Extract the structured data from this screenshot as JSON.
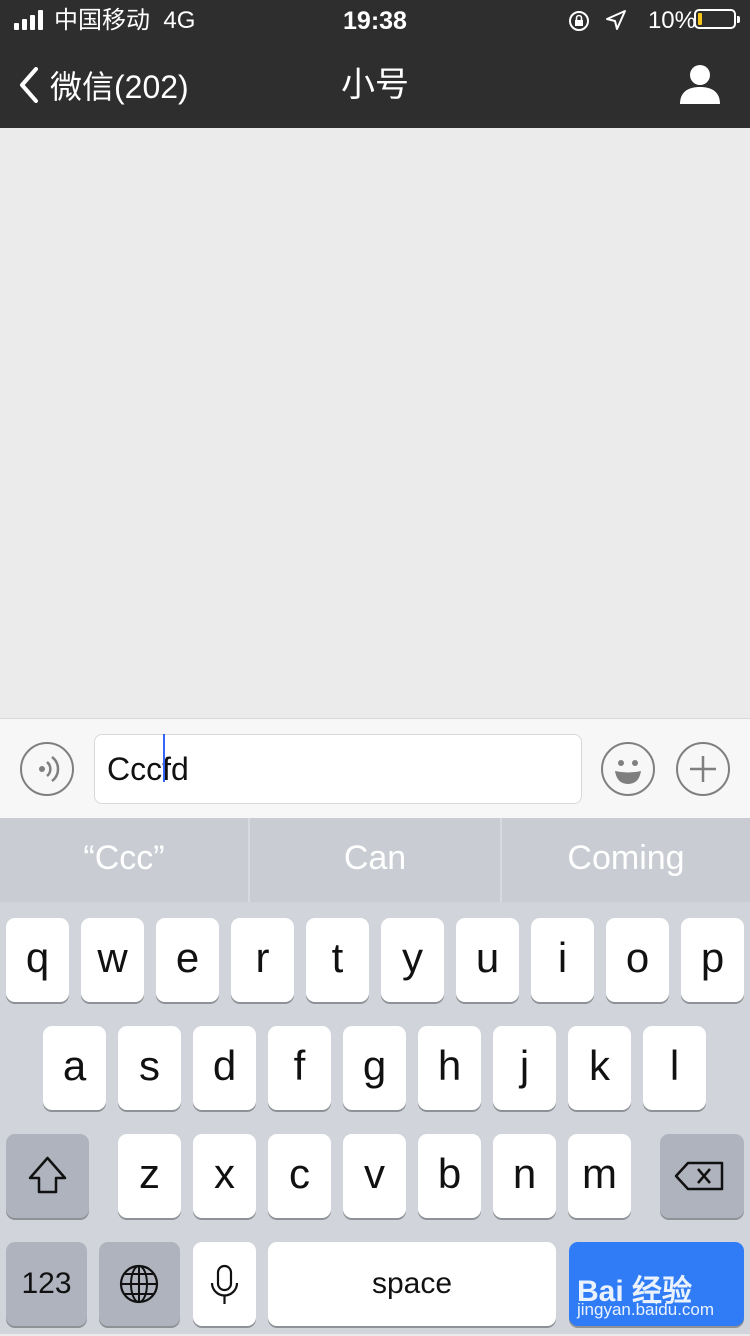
{
  "status_bar": {
    "carrier": "中国移动",
    "network": "4G",
    "time": "19:38",
    "battery_percent": "10%",
    "battery_color": "#f5c518"
  },
  "nav": {
    "back_label": "微信(202)",
    "title": "小号",
    "profile_icon": "person-icon"
  },
  "chat": {
    "input_value": "Cccfd",
    "voice_icon": "voice-icon",
    "emoji_icon": "emoji-icon",
    "plus_icon": "plus-icon"
  },
  "keyboard": {
    "suggestions": [
      "“Ccc”",
      "Can",
      "Coming"
    ],
    "row1": [
      "q",
      "w",
      "e",
      "r",
      "t",
      "y",
      "u",
      "i",
      "o",
      "p"
    ],
    "row2": [
      "a",
      "s",
      "d",
      "f",
      "g",
      "h",
      "j",
      "k",
      "l"
    ],
    "row3": [
      "z",
      "x",
      "c",
      "v",
      "b",
      "n",
      "m"
    ],
    "numbers_label": "123",
    "space_label": "space",
    "shift_icon": "shift-icon",
    "delete_icon": "backspace-icon",
    "globe_icon": "globe-icon",
    "mic_icon": "microphone-icon"
  },
  "watermark": {
    "brand": "Bai 经验",
    "url": "jingyan.baidu.com"
  },
  "colors": {
    "nav_bg": "#2e2e2e",
    "chat_bg": "#ebebeb",
    "keyboard_bg": "#d1d4db",
    "accent_blue": "#2f7cf6"
  }
}
